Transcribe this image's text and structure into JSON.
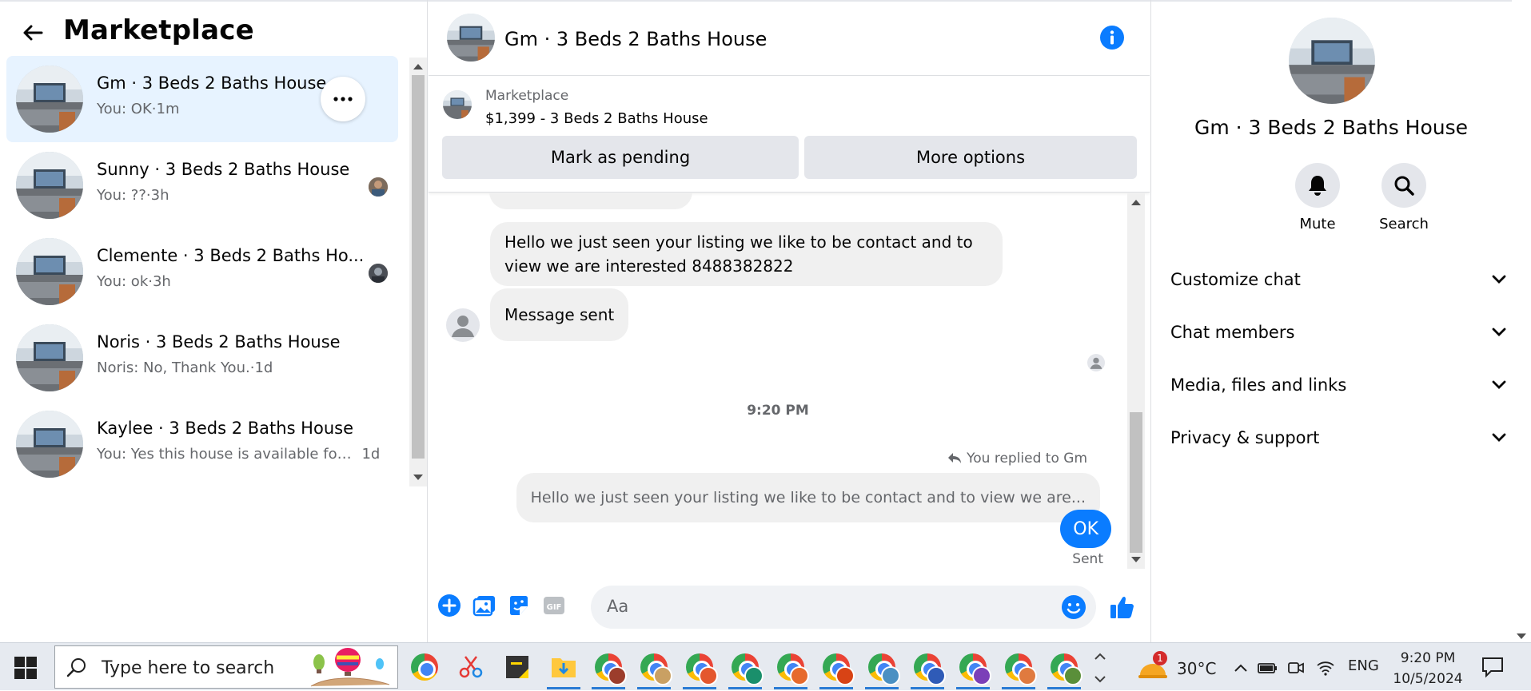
{
  "left": {
    "title": "Marketplace",
    "conversations": [
      {
        "name": "Gm · 3 Beds 2 Baths House",
        "preview": "You: OK",
        "time": "1m",
        "active": true
      },
      {
        "name": "Sunny · 3 Beds 2 Baths House",
        "preview": "You: ??",
        "time": "3h"
      },
      {
        "name": "Clemente · 3 Beds 2 Baths Ho...",
        "preview": "You: ok",
        "time": "3h"
      },
      {
        "name": "Noris · 3 Beds 2 Baths House",
        "preview": "Noris: No, Thank You.",
        "time": "1d"
      },
      {
        "name": "Kaylee · 3 Beds 2 Baths House",
        "preview": "You: Yes this house is available for r...",
        "time": "1d"
      }
    ]
  },
  "chat": {
    "title": "Gm · 3 Beds 2 Baths House",
    "listing_label": "Marketplace",
    "listing_price": "$1,399 - 3 Beds 2 Baths House",
    "mark_pending_label": "Mark as pending",
    "more_options_label": "More options",
    "messages": {
      "msg1": "Hello we just seen your listing we like to be contact and to view we are interested 8488382822",
      "msg2": "Message sent",
      "timestamp": "9:20 PM",
      "reply_label": "You replied to Gm",
      "reply_quote": "Hello we just seen your listing we like to be contact and to view we are...",
      "outgoing": "OK",
      "status": "Sent"
    },
    "composer_placeholder": "Aa",
    "accent": "#0a7cff"
  },
  "right": {
    "name": "Gm · 3 Beds 2 Baths House",
    "mute_label": "Mute",
    "search_label": "Search",
    "sections": [
      "Customize chat",
      "Chat members",
      "Media, files and links",
      "Privacy & support"
    ]
  },
  "taskbar": {
    "search_placeholder": "Type here to search",
    "weather_temp": "30°C",
    "weather_badge": "1",
    "language": "ENG",
    "time": "9:20 PM",
    "date": "10/5/2024"
  }
}
